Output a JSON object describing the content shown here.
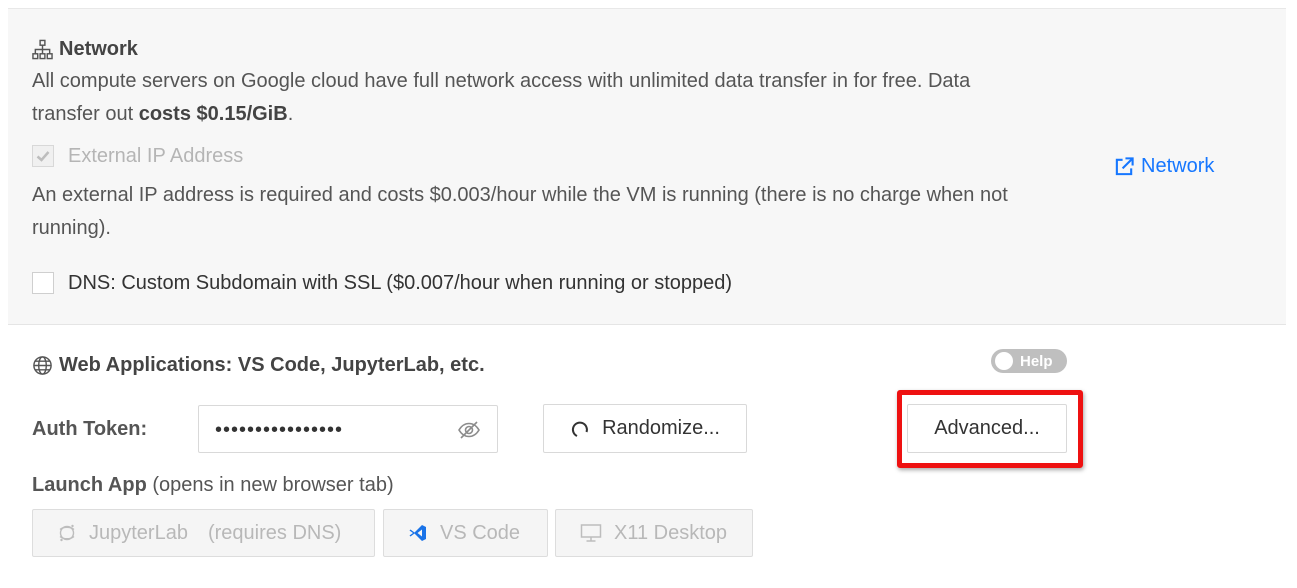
{
  "network": {
    "title": "Network",
    "desc_prefix": "All compute servers on Google cloud have full network access with unlimited data transfer in for free. Data",
    "desc_line2_prefix": "transfer out ",
    "desc_bold": "costs $0.15/GiB",
    "desc_suffix": ".",
    "external_ip_label": "External IP Address",
    "external_ip_checked": true,
    "external_ip_note_line1": "An external IP address is required and costs $0.003/hour while the VM is running (there is no charge when not",
    "external_ip_note_line2": "running).",
    "dns_label": "DNS: Custom Subdomain with SSL ($0.007/hour when running or stopped)",
    "dns_checked": false,
    "link_label": "Network"
  },
  "web_apps": {
    "title": "Web Applications: VS Code, JupyterLab, etc.",
    "help_label": "Help",
    "auth_token_label": "Auth Token:",
    "auth_token_value": "••••••••••••••••",
    "randomize_label": "Randomize...",
    "advanced_label": "Advanced...",
    "launch_label": "Launch App",
    "launch_note": " (opens in new browser tab)",
    "apps": [
      {
        "label": "JupyterLab",
        "note": "(requires DNS)"
      },
      {
        "label": "VS Code"
      },
      {
        "label": "X11 Desktop"
      }
    ]
  },
  "colors": {
    "link": "#1677ff",
    "highlight": "#ee1111",
    "vscode": "#1a73e8"
  }
}
